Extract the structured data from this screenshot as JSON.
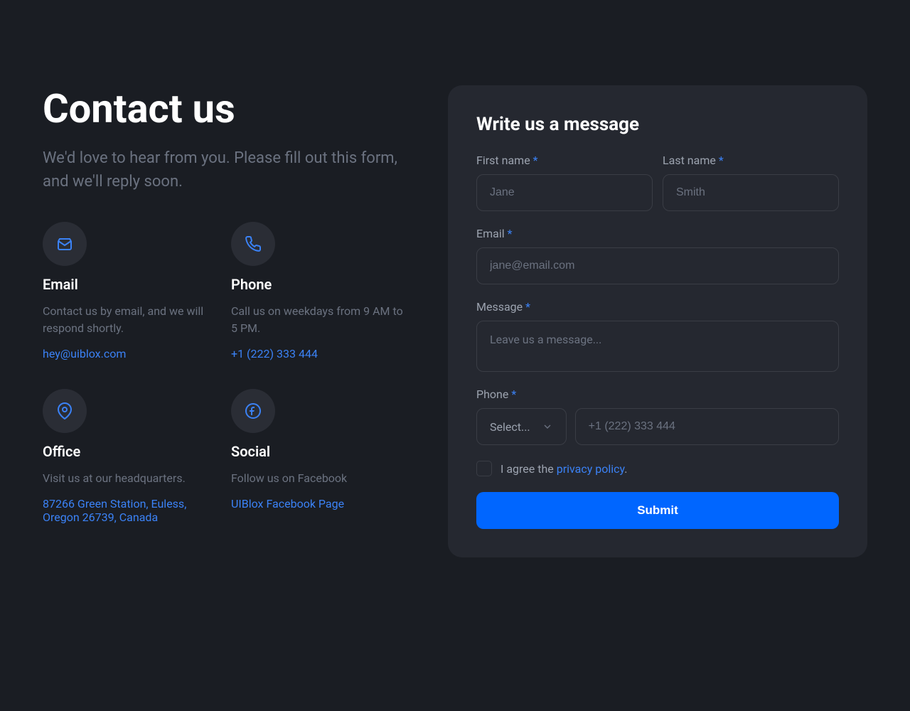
{
  "header": {
    "title": "Contact us",
    "description": "We'd love to hear from you. Please fill out this form, and we'll reply soon."
  },
  "info_cards": {
    "email": {
      "title": "Email",
      "description": "Contact us by email, and we will respond shortly.",
      "link": "hey@uiblox.com"
    },
    "phone": {
      "title": "Phone",
      "description": "Call us on weekdays from 9 AM to 5 PM.",
      "link": "+1 (222) 333 444"
    },
    "office": {
      "title": "Office",
      "description": "Visit us at our headquarters.",
      "link": "87266 Green Station, Euless, Oregon 26739, Canada"
    },
    "social": {
      "title": "Social",
      "description": "Follow us on Facebook",
      "link": "UIBlox Facebook Page"
    }
  },
  "form": {
    "title": "Write us a message",
    "first_name": {
      "label": "First name",
      "placeholder": "Jane"
    },
    "last_name": {
      "label": "Last name",
      "placeholder": "Smith"
    },
    "email": {
      "label": "Email",
      "placeholder": "jane@email.com"
    },
    "message": {
      "label": "Message",
      "placeholder": "Leave us a message..."
    },
    "phone": {
      "label": "Phone",
      "select_label": "Select...",
      "placeholder": "+1 (222) 333 444"
    },
    "agreement": {
      "text_before": "I agree the ",
      "link_text": "privacy policy",
      "text_after": "."
    },
    "submit_label": "Submit",
    "required_mark": "*"
  }
}
